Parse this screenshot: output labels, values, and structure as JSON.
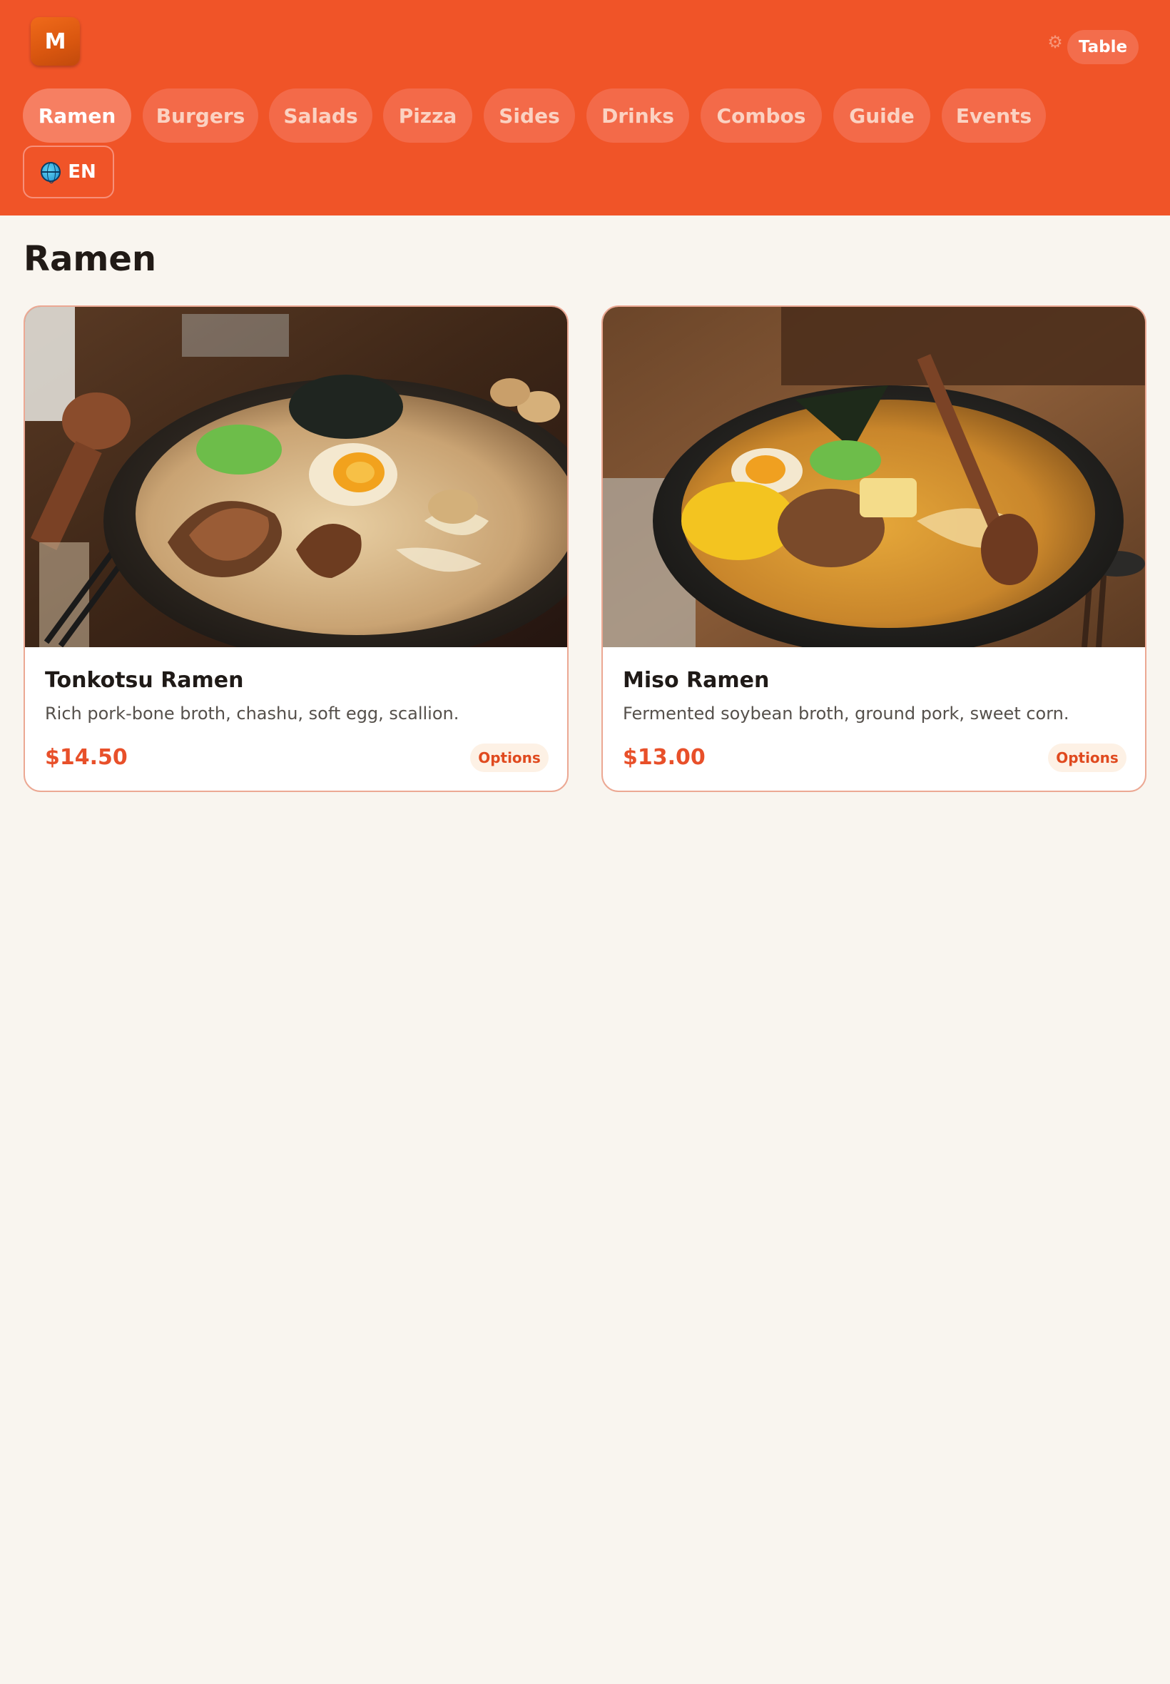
{
  "header": {
    "logo_text": "M",
    "settings_icon": "gear-icon",
    "table_label": "Table",
    "tabs": [
      {
        "label": "Ramen",
        "active": true
      },
      {
        "label": "Burgers",
        "active": false
      },
      {
        "label": "Salads",
        "active": false
      },
      {
        "label": "Pizza",
        "active": false
      },
      {
        "label": "Sides",
        "active": false
      },
      {
        "label": "Drinks",
        "active": false
      },
      {
        "label": "Combos",
        "active": false
      },
      {
        "label": "Guide",
        "active": false
      },
      {
        "label": "Events",
        "active": false
      }
    ],
    "language": {
      "icon": "globe-icon",
      "label": "EN"
    }
  },
  "colors": {
    "header_bg": "#f05428",
    "page_bg": "#f9f5ef",
    "accent": "#e8502a",
    "card_border": "#eca893"
  },
  "main": {
    "section_title": "Ramen",
    "items": [
      {
        "name": "Tonkotsu Ramen",
        "description": "Rich pork-bone broth, chashu, soft egg, scallion.",
        "price": "$14.50",
        "options_label": "Options",
        "image": "tonkotsu-ramen-photo"
      },
      {
        "name": "Miso Ramen",
        "description": "Fermented soybean broth, ground pork, sweet corn.",
        "price": "$13.00",
        "options_label": "Options",
        "image": "miso-ramen-photo"
      }
    ]
  }
}
